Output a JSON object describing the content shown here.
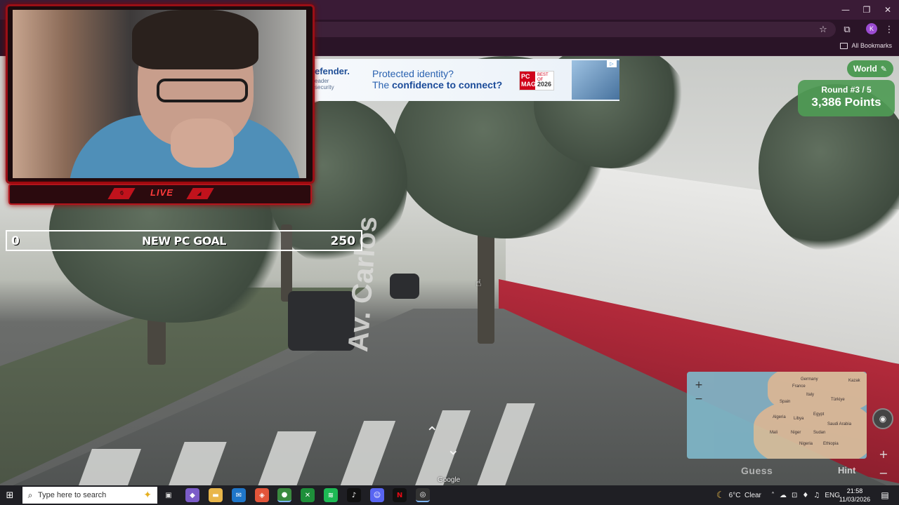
{
  "browser": {
    "window_controls": {
      "minimize": "—",
      "restore": "❐",
      "close": "✕"
    },
    "toolbar": {
      "star_icon": "☆",
      "extensions_icon": "⧉",
      "profile_initial": "K",
      "menu_icon": "⋮"
    },
    "bookmarks": {
      "all_bookmarks_label": "All Bookmarks"
    }
  },
  "ad": {
    "brand": "efender.",
    "brand_sub": "eader\nsecurity",
    "line1": "Protected identity?",
    "line2_prefix": "The ",
    "line2_bold": "confidence to connect?",
    "badge_pc": "PC MAG",
    "badge_label": "BEST OF",
    "badge_year": "2026",
    "info_icon": "▷"
  },
  "stream_overlay": {
    "live_label": "LIVE",
    "goal": {
      "current": "0",
      "title": "NEW PC GOAL",
      "target": "250"
    }
  },
  "game": {
    "mode_label": "World",
    "round_label": "Round #3 / 5",
    "points_label": "3,386 Points",
    "guess_label": "Guess",
    "hint_label": "Hint",
    "zoom_in": "+",
    "zoom_out": "−",
    "map_labels": [
      "Germany",
      "France",
      "Italy",
      "Spain",
      "Türkiye",
      "Algeria",
      "Egypt",
      "Libya",
      "Saudi Arabia",
      "Mali",
      "Niger",
      "Sudan",
      "Nigeria",
      "Ethiopia",
      "Kazak"
    ]
  },
  "street_view": {
    "street_name": "Av. Carlos",
    "attribution": "Google"
  },
  "side_controls": {
    "plus": "+",
    "minus": "−"
  },
  "taskbar": {
    "search_placeholder": "Type here to search",
    "weather": "6°C  Clear",
    "language": "ENG",
    "time": "21:58",
    "date": "11/03/2026"
  },
  "colors": {
    "hud_green": "#4f9b55",
    "overlay_red": "#b3141c",
    "browser_purple": "#3a1b36"
  }
}
